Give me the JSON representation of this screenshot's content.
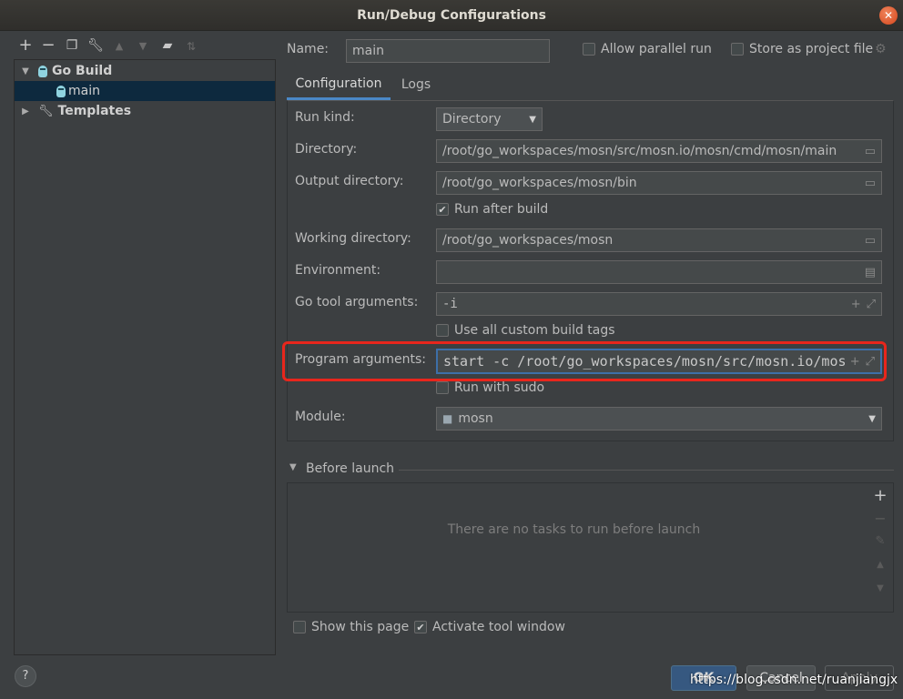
{
  "window": {
    "title": "Run/Debug Configurations"
  },
  "toolbar": {
    "icons": [
      "add-icon",
      "remove-icon",
      "copy-icon",
      "wrench-icon",
      "move-up-icon",
      "move-down-icon",
      "folder-icon",
      "sort-icon"
    ],
    "add": "+",
    "remove": "−"
  },
  "tree": {
    "go_build": "Go Build",
    "main": "main",
    "templates": "Templates"
  },
  "name": {
    "label": "Name:",
    "value": "main"
  },
  "allow_parallel": {
    "label": "Allow parallel run",
    "checked": false
  },
  "store_project": {
    "label": "Store as project file",
    "checked": false
  },
  "tabs": {
    "configuration": "Configuration",
    "logs": "Logs"
  },
  "form": {
    "run_kind": {
      "label": "Run kind:",
      "value": "Directory"
    },
    "directory": {
      "label": "Directory:",
      "value": "/root/go_workspaces/mosn/src/mosn.io/mosn/cmd/mosn/main"
    },
    "output_directory": {
      "label": "Output directory:",
      "value": "/root/go_workspaces/mosn/bin"
    },
    "run_after_build": {
      "label": "Run after build",
      "checked": true
    },
    "working_directory": {
      "label": "Working directory:",
      "value": "/root/go_workspaces/mosn"
    },
    "environment": {
      "label": "Environment:",
      "value": ""
    },
    "go_tool_arguments": {
      "label": "Go tool arguments:",
      "value": "-i"
    },
    "use_custom_build_tags": {
      "label": "Use all custom build tags",
      "checked": false
    },
    "program_arguments": {
      "label": "Program arguments:",
      "value": "start -c /root/go_workspaces/mosn/src/mosn.io/mos"
    },
    "run_with_sudo": {
      "label": "Run with sudo",
      "checked": false
    },
    "module": {
      "label": "Module:",
      "value": "mosn"
    }
  },
  "before_launch": {
    "title": "Before launch",
    "empty_text": "There are no tasks to run before launch"
  },
  "show_this_page": {
    "label": "Show this page",
    "checked": false
  },
  "activate_tool_window": {
    "label": "Activate tool window",
    "checked": true
  },
  "buttons": {
    "help": "?",
    "ok": "OK",
    "cancel": "Cancel",
    "apply": "Apply"
  },
  "watermark": "https://blog.csdn.net/ruanjiangjx",
  "colors": {
    "accent": "#4a88c7",
    "highlight": "#e8261c",
    "background": "#3c3f41",
    "selection": "#0d293e"
  }
}
